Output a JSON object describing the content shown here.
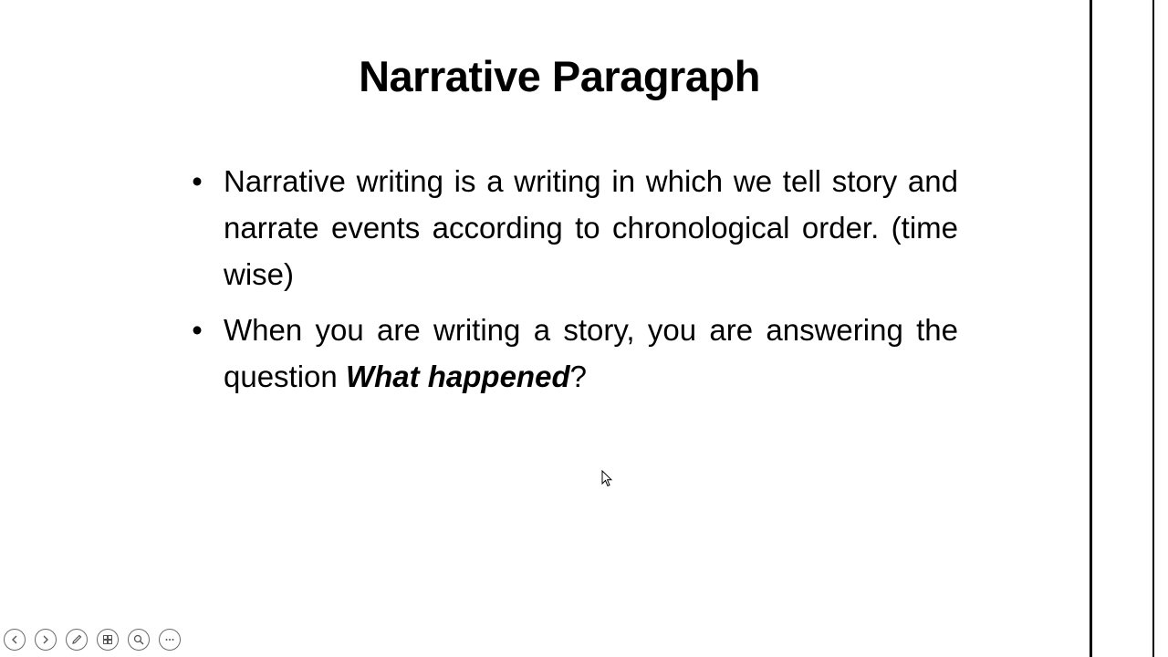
{
  "slide": {
    "title": "Narrative Paragraph",
    "bullets": [
      {
        "marker": "•",
        "text": "Narrative writing is a writing in which we tell story and narrate events according to chronological order. (time wise)"
      },
      {
        "marker": "•",
        "text_before": "When you are writing a story, you are answering the question ",
        "emphasis": "What happened",
        "text_after": "?"
      }
    ]
  },
  "toolbar": {
    "buttons": [
      {
        "name": "previous-slide-button",
        "icon": "arrow-left-icon"
      },
      {
        "name": "next-slide-button",
        "icon": "arrow-right-icon"
      },
      {
        "name": "pen-tool-button",
        "icon": "pen-icon"
      },
      {
        "name": "see-all-slides-button",
        "icon": "slides-grid-icon"
      },
      {
        "name": "zoom-button",
        "icon": "magnifier-icon"
      },
      {
        "name": "more-options-button",
        "icon": "ellipsis-icon"
      }
    ]
  },
  "colors": {
    "background": "#ffffff",
    "text": "#000000",
    "toolbar_stroke": "#6a6a6a"
  }
}
